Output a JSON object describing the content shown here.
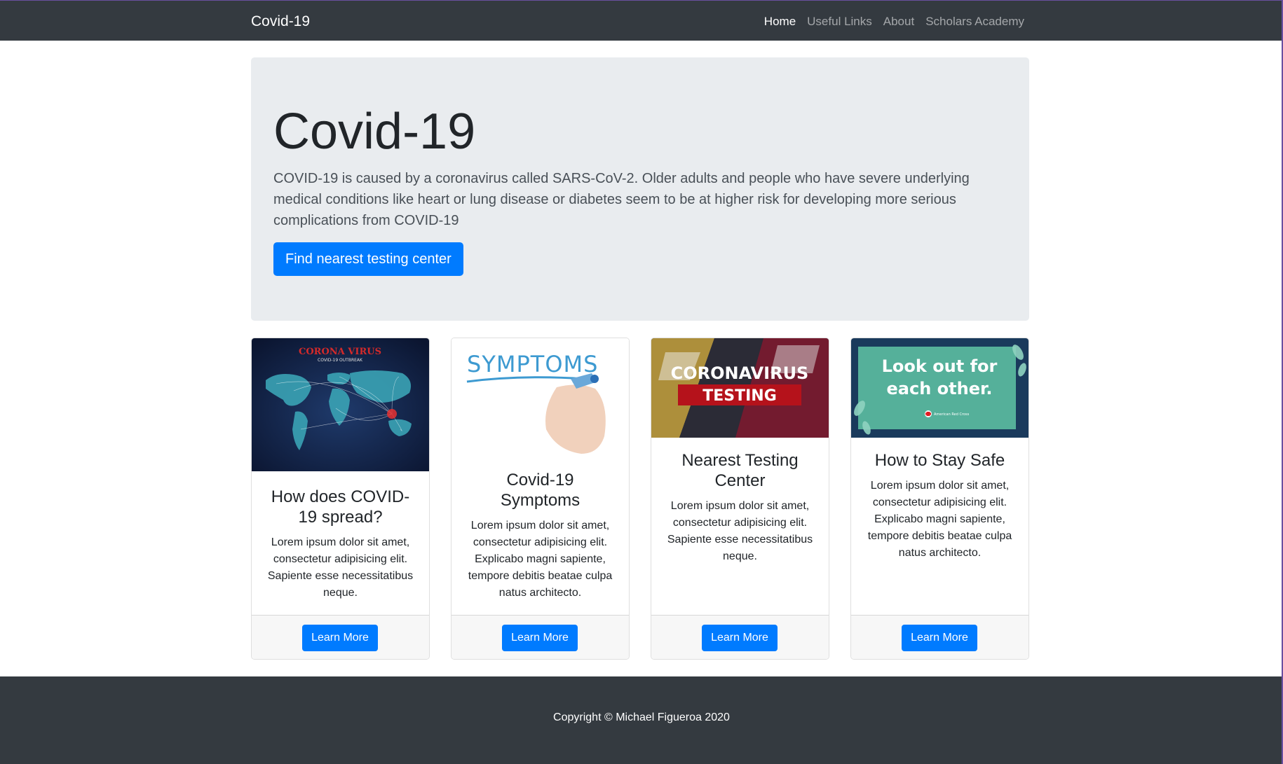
{
  "navbar": {
    "brand": "Covid-19",
    "items": [
      {
        "label": "Home",
        "active": true
      },
      {
        "label": "Useful Links",
        "active": false
      },
      {
        "label": "About",
        "active": false
      },
      {
        "label": "Scholars Academy",
        "active": false
      }
    ]
  },
  "hero": {
    "title": "Covid-19",
    "lead": "COVID-19 is caused by a coronavirus called SARS-CoV-2. Older adults and people who have severe underlying medical conditions like heart or lung disease or diabetes seem to be at higher risk for developing more serious complications from COVID-19",
    "button_label": "Find nearest testing center"
  },
  "cards": [
    {
      "image_text": {
        "line1": "CORONA VIRUS",
        "line2": "COVID-19 OUTBREAK"
      },
      "title": "How does COVID-19 spread?",
      "text": "Lorem ipsum dolor sit amet, consectetur adipisicing elit. Sapiente esse necessitatibus neque.",
      "button_label": "Learn More"
    },
    {
      "image_text": {
        "line1": "SYMPTOMS"
      },
      "title": "Covid-19 Symptoms",
      "text": "Lorem ipsum dolor sit amet, consectetur adipisicing elit. Explicabo magni sapiente, tempore debitis beatae culpa natus architecto.",
      "button_label": "Learn More"
    },
    {
      "image_text": {
        "line1": "CORONAVIRUS",
        "line2": "TESTING"
      },
      "title": "Nearest Testing Center",
      "text": "Lorem ipsum dolor sit amet, consectetur adipisicing elit. Sapiente esse necessitatibus neque.",
      "button_label": "Learn More"
    },
    {
      "image_text": {
        "line1": "Look out for",
        "line2": "each other.",
        "logo": "American Red Cross"
      },
      "title": "How to Stay Safe",
      "text": "Lorem ipsum dolor sit amet, consectetur adipisicing elit. Explicabo magni sapiente, tempore debitis beatae culpa natus architecto.",
      "button_label": "Learn More"
    }
  ],
  "footer": {
    "copyright": "Copyright © Michael Figueroa 2020"
  },
  "colors": {
    "navbar": "#343a40",
    "primary": "#007bff",
    "jumbotron": "#e9ecef"
  }
}
